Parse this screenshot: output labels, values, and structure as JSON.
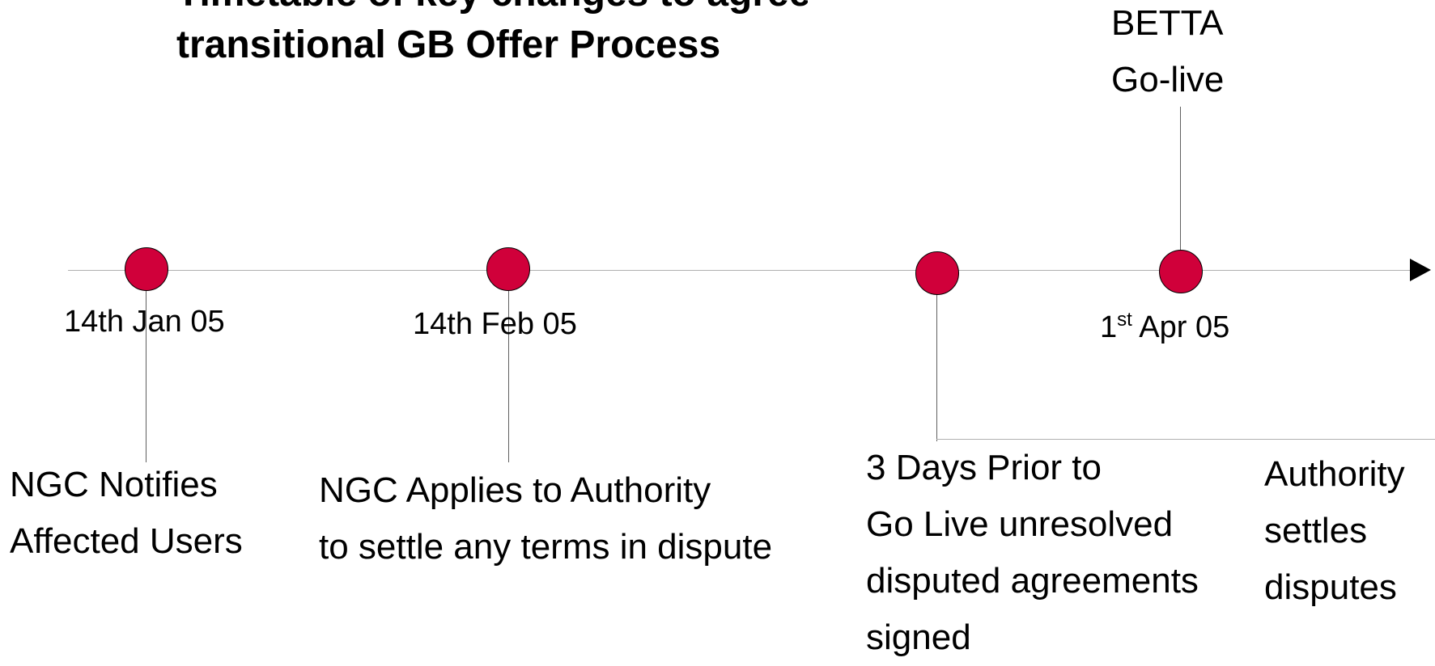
{
  "title": {
    "line1": "Timetable of key changes to agreements",
    "line2": "transitional GB Offer Process"
  },
  "colors": {
    "marker_fill": "#d0003a",
    "axis_line": "#b0b0b0",
    "leader_line": "#606060",
    "arrow": "#000000"
  },
  "milestones": [
    {
      "date": "14th Jan 05",
      "description": [
        "NGC Notifies",
        "Affected Users"
      ]
    },
    {
      "date": "14th Feb 05",
      "description": [
        "NGC Applies to Authority",
        "to settle any terms in dispute"
      ]
    },
    {
      "date": "",
      "description": [
        "3 Days Prior to",
        "Go Live unresolved",
        "disputed agreements",
        "signed"
      ]
    },
    {
      "date_day": "1",
      "date_suffix": "st",
      "date_rest": " Apr 05",
      "label_above": [
        "BETTA",
        "Go-live"
      ],
      "description": [
        "Authority",
        "settles",
        "disputes"
      ]
    }
  ]
}
